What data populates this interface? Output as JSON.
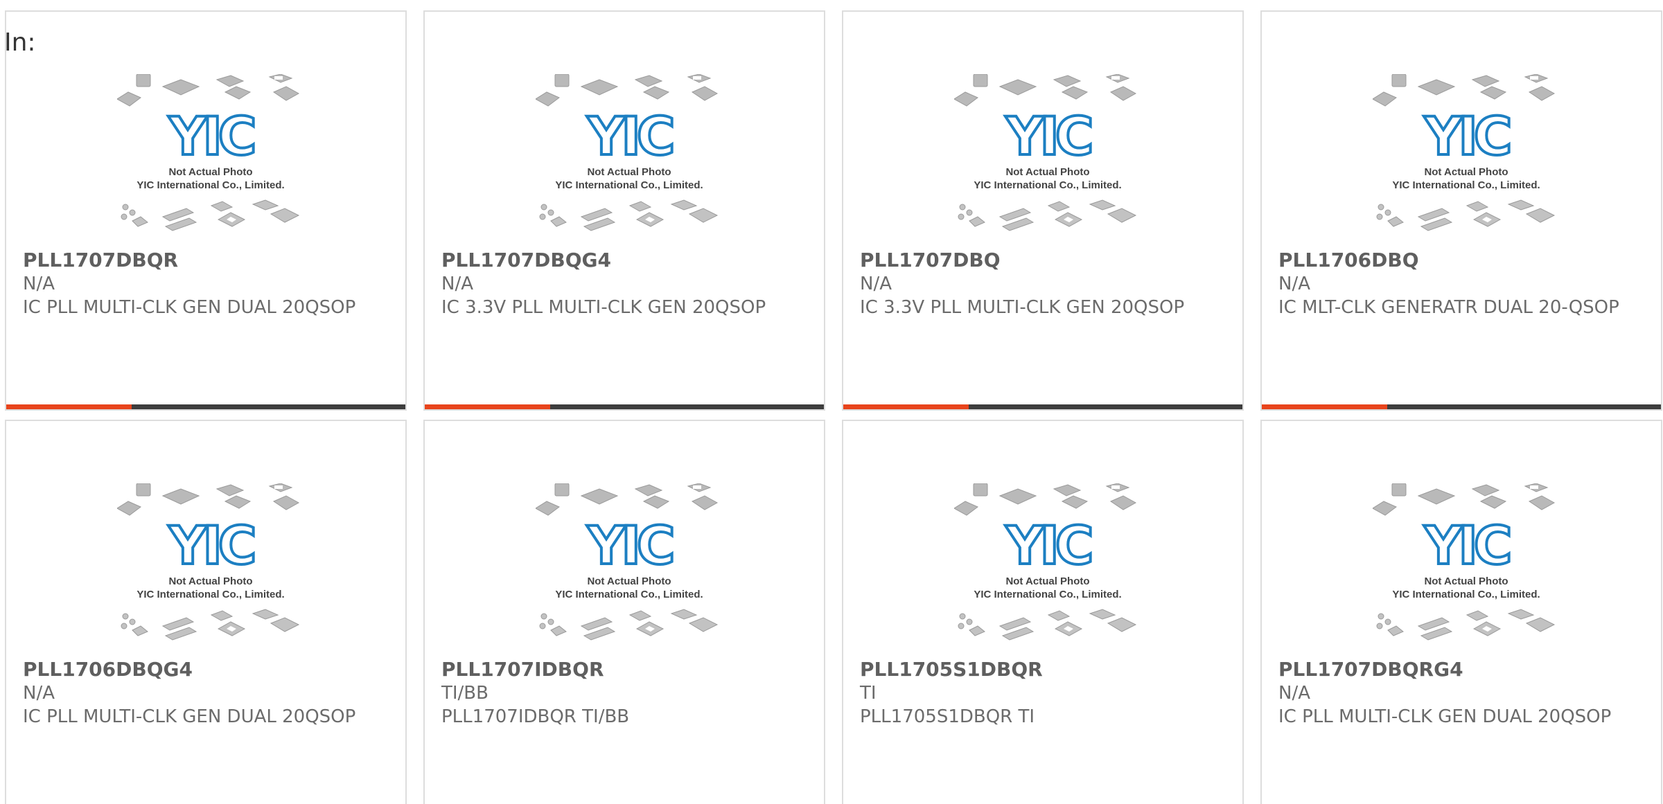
{
  "page": {
    "in_label": "In:"
  },
  "photo": {
    "logo_text": "YIC",
    "caption_line1": "Not Actual Photo",
    "caption_line2": "YIC International Co., Limited.",
    "logo_color": "#1c7fc2"
  },
  "colors": {
    "accent": "#e8441c",
    "bar_track": "#3d3d3d",
    "card_border": "#dddddd"
  },
  "cards": [
    {
      "part_no": "PLL1707DBQR",
      "mfr": "N/A",
      "desc": "IC PLL MULTI-CLK GEN DUAL 20QSOP",
      "progress": 0.315
    },
    {
      "part_no": "PLL1707DBQG4",
      "mfr": "N/A",
      "desc": "IC 3.3V PLL MULTI-CLK GEN 20QSOP",
      "progress": 0.315
    },
    {
      "part_no": "PLL1707DBQ",
      "mfr": "N/A",
      "desc": "IC 3.3V PLL MULTI-CLK GEN 20QSOP",
      "progress": 0.315
    },
    {
      "part_no": "PLL1706DBQ",
      "mfr": "N/A",
      "desc": "IC MLT-CLK GENERATR DUAL 20-QSOP",
      "progress": 0.315
    },
    {
      "part_no": "PLL1706DBQG4",
      "mfr": "N/A",
      "desc": "IC PLL MULTI-CLK GEN DUAL 20QSOP"
    },
    {
      "part_no": "PLL1707IDBQR",
      "mfr": "TI/BB",
      "desc": "PLL1707IDBQR TI/BB"
    },
    {
      "part_no": "PLL1705S1DBQR",
      "mfr": "TI",
      "desc": "PLL1705S1DBQR TI"
    },
    {
      "part_no": "PLL1707DBQRG4",
      "mfr": "N/A",
      "desc": "IC PLL MULTI-CLK GEN DUAL 20QSOP"
    }
  ]
}
